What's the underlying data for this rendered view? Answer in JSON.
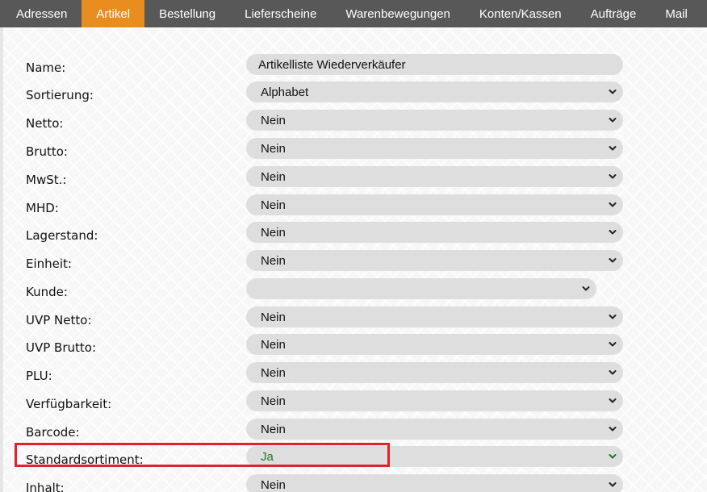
{
  "nav": {
    "items": [
      {
        "label": "Adressen"
      },
      {
        "label": "Artikel"
      },
      {
        "label": "Bestellung"
      },
      {
        "label": "Lieferscheine"
      },
      {
        "label": "Warenbewegungen"
      },
      {
        "label": "Konten/Kassen"
      },
      {
        "label": "Aufträge"
      },
      {
        "label": "Mail"
      }
    ],
    "active_index": 1
  },
  "colors": {
    "nav_bg": "#585858",
    "nav_active": "#e98e1e",
    "field_bg": "#dedede",
    "highlight": "#e0222a",
    "value_green": "#1a7a1a"
  },
  "form": {
    "fields": [
      {
        "label": "Name:",
        "type": "input",
        "value": "Artikelliste Wiederverkäufer"
      },
      {
        "label": "Sortierung:",
        "type": "select",
        "value": "Alphabet"
      },
      {
        "label": "Netto:",
        "type": "select",
        "value": "Nein"
      },
      {
        "label": "Brutto:",
        "type": "select",
        "value": "Nein"
      },
      {
        "label": "MwSt.:",
        "type": "select",
        "value": "Nein"
      },
      {
        "label": "MHD:",
        "type": "select",
        "value": "Nein"
      },
      {
        "label": "Lagerstand:",
        "type": "select",
        "value": "Nein"
      },
      {
        "label": "Einheit:",
        "type": "select",
        "value": "Nein"
      },
      {
        "label": "Kunde:",
        "type": "select",
        "value": ""
      },
      {
        "label": "UVP Netto:",
        "type": "select",
        "value": "Nein"
      },
      {
        "label": "UVP Brutto:",
        "type": "select",
        "value": "Nein"
      },
      {
        "label": "PLU:",
        "type": "select",
        "value": "Nein"
      },
      {
        "label": "Verfügbarkeit:",
        "type": "select",
        "value": "Nein"
      },
      {
        "label": "Barcode:",
        "type": "select",
        "value": "Nein"
      },
      {
        "label": "Standardsortiment:",
        "type": "select",
        "value": "Ja",
        "highlighted": true
      },
      {
        "label": "Inhalt:",
        "type": "select",
        "value": "Nein"
      }
    ]
  },
  "icons": {
    "select_arrow": "chevron-down-icon"
  }
}
